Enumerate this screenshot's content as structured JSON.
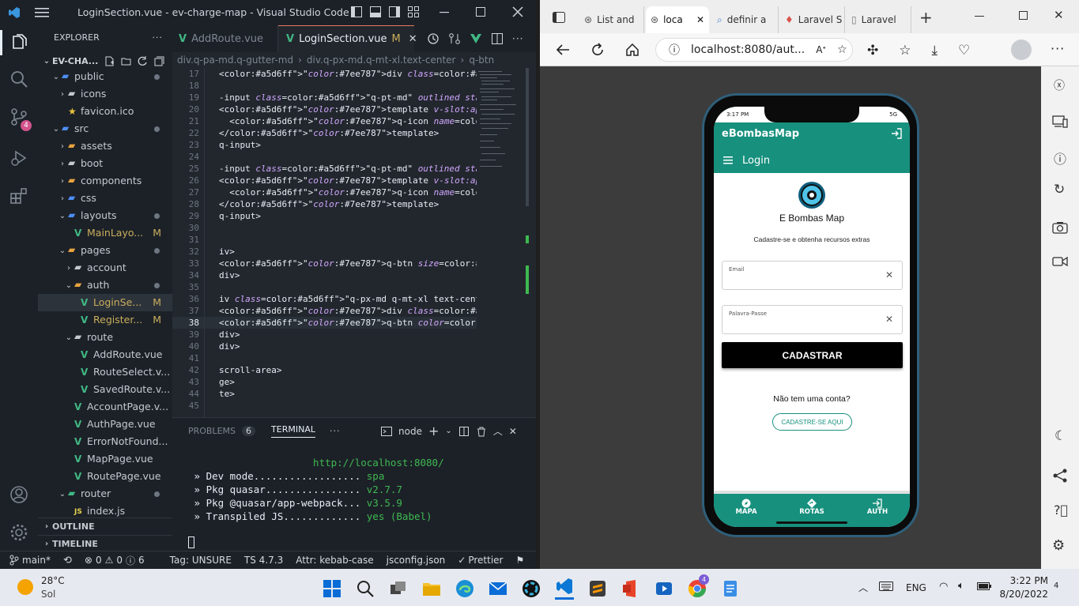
{
  "vscode": {
    "window_title": "LoginSection.vue - ev-charge-map - Visual Studio Code",
    "explorer_title": "EXPLORER",
    "project_root": "EV-CHA...",
    "tree": [
      {
        "label": "public",
        "kind": "folder"
      },
      {
        "label": "icons",
        "kind": "folder"
      },
      {
        "label": "favicon.ico",
        "kind": "file"
      },
      {
        "label": "src",
        "kind": "folder"
      },
      {
        "label": "assets",
        "kind": "folder"
      },
      {
        "label": "boot",
        "kind": "folder"
      },
      {
        "label": "components",
        "kind": "folder"
      },
      {
        "label": "css",
        "kind": "folder"
      },
      {
        "label": "layouts",
        "kind": "folder"
      },
      {
        "label": "MainLayo...",
        "kind": "vue",
        "badge": "M"
      },
      {
        "label": "pages",
        "kind": "folder"
      },
      {
        "label": "account",
        "kind": "folder"
      },
      {
        "label": "auth",
        "kind": "folder"
      },
      {
        "label": "LoginSe...",
        "kind": "vue",
        "badge": "M"
      },
      {
        "label": "Register...",
        "kind": "vue",
        "badge": "M"
      },
      {
        "label": "route",
        "kind": "folder"
      },
      {
        "label": "AddRoute.vue",
        "kind": "vue"
      },
      {
        "label": "RouteSelect.v...",
        "kind": "vue"
      },
      {
        "label": "SavedRoute.v...",
        "kind": "vue"
      },
      {
        "label": "AccountPage.v...",
        "kind": "vue"
      },
      {
        "label": "AuthPage.vue",
        "kind": "vue"
      },
      {
        "label": "ErrorNotFound...",
        "kind": "vue"
      },
      {
        "label": "MapPage.vue",
        "kind": "vue"
      },
      {
        "label": "RoutePage.vue",
        "kind": "vue"
      },
      {
        "label": "router",
        "kind": "folder"
      },
      {
        "label": "index.js",
        "kind": "js"
      }
    ],
    "outline_label": "OUTLINE",
    "timeline_label": "TIMELINE",
    "tabs": [
      {
        "label": "AddRoute.vue",
        "active": false
      },
      {
        "label": "LoginSection.vue",
        "badge": "M",
        "active": true
      }
    ],
    "breadcrumb": [
      "div.q-pa-md.q-gutter-md",
      "div.q-px-md.q-mt-xl.text-center",
      "q-btn"
    ],
    "code_lines": [
      {
        "n": "17",
        "text": "<div class=\"text-center\">Cadastre-se e obtenha recurso"
      },
      {
        "n": "18",
        "text": ""
      },
      {
        "n": "19",
        "text": "-input class=\"q-pt-md\" outlined stack-label label=\"Ema"
      },
      {
        "n": "20",
        "text": "<template v-slot:append>"
      },
      {
        "n": "21",
        "text": "  <q-icon name=\"close\" />"
      },
      {
        "n": "22",
        "text": "</template>"
      },
      {
        "n": "23",
        "text": "q-input>"
      },
      {
        "n": "24",
        "text": ""
      },
      {
        "n": "25",
        "text": "-input class=\"q-pt-md\" outlined stack-label label=\"Pal"
      },
      {
        "n": "26",
        "text": "<template v-slot:append>"
      },
      {
        "n": "27",
        "text": "  <q-icon name=\"close\" />"
      },
      {
        "n": "28",
        "text": "</template>"
      },
      {
        "n": "29",
        "text": "q-input>"
      },
      {
        "n": "30",
        "text": ""
      },
      {
        "n": "31",
        "text": ""
      },
      {
        "n": "32",
        "text": "iv>"
      },
      {
        "n": "33",
        "text": "<q-btn size=\"lg\" class=\"full-width\" color=\"black\" labe"
      },
      {
        "n": "34",
        "text": "div>"
      },
      {
        "n": "35",
        "text": ""
      },
      {
        "n": "36",
        "text": "iv class=\"q-px-md q-mt-xl text-center\">"
      },
      {
        "n": "37",
        "text": "<div class=\"q-mb-md no-account\">Não tem uma conta?</di"
      },
      {
        "n": "38",
        "text": "<q-btn color=\"teal\" rounded outline to=\"/auth/register"
      },
      {
        "n": "39",
        "text": "div>"
      },
      {
        "n": "40",
        "text": "div>"
      },
      {
        "n": "41",
        "text": ""
      },
      {
        "n": "42",
        "text": "scroll-area>"
      },
      {
        "n": "43",
        "text": "ge>"
      },
      {
        "n": "44",
        "text": "te>"
      },
      {
        "n": "45",
        "text": ""
      }
    ],
    "panel": {
      "problems_label": "PROBLEMS",
      "problems_count": "6",
      "terminal_label": "TERMINAL",
      "shell_label": "node",
      "lines": [
        "                     http://localhost:8080/",
        " » Dev mode.................. spa",
        " » Pkg quasar................ v2.7.7",
        " » Pkg @quasar/app-webpack... v3.5.9",
        " » Transpiled JS............. yes (Babel)"
      ]
    },
    "status": {
      "branch": "main*",
      "errors": "0",
      "warnings": "0",
      "infos": "6",
      "tag": "Tag: UNSURE",
      "ts": "TS 4.7.3",
      "attr": "Attr: kebab-case",
      "jsconfig": "jsconfig.json",
      "prettier": "Prettier"
    },
    "scm_badge": "4"
  },
  "browser": {
    "tabs": [
      {
        "label": "List and",
        "active": false
      },
      {
        "label": "loca",
        "active": true
      },
      {
        "label": "definir a",
        "active": false
      },
      {
        "label": "Laravel S",
        "active": false
      },
      {
        "label": "Laravel",
        "active": false
      }
    ],
    "url": "localhost:8080/aut..."
  },
  "app": {
    "status_time": "3:17 PM",
    "status_net": "5G",
    "brand": "eBombasMap",
    "page_title": "Login",
    "logo_text": "E Bombas Map",
    "subtitle": "Cadastre-se e obtenha recursos extras",
    "email_label": "Email",
    "password_label": "Palavra-Passe",
    "submit_label": "CADASTRAR",
    "no_account": "Não tem uma conta?",
    "register_label": "CADASTRE-SE AQUI",
    "nav": [
      {
        "label": "MAPA",
        "icon": "compass-icon"
      },
      {
        "label": "ROTAS",
        "icon": "directions-icon"
      },
      {
        "label": "AUTH",
        "icon": "login-icon"
      }
    ],
    "accent": "#17907e"
  },
  "taskbar": {
    "weather_temp": "28°C",
    "weather_desc": "Sol",
    "language": "ENG",
    "time": "3:22 PM",
    "date": "8/20/2022",
    "notif_count": "4",
    "chrome_badge": "4"
  }
}
